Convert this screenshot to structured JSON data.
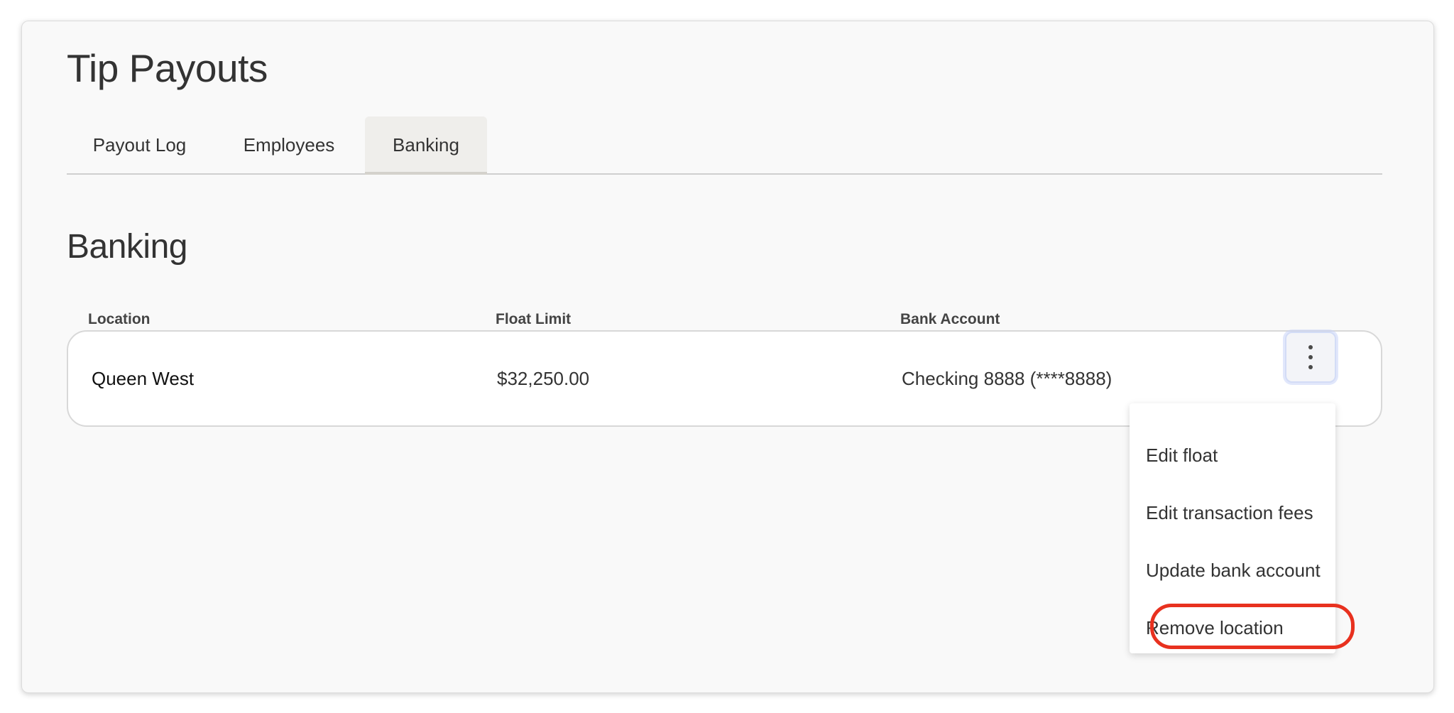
{
  "header": {
    "title": "Tip Payouts"
  },
  "tabs": [
    {
      "label": "Payout Log",
      "active": false
    },
    {
      "label": "Employees",
      "active": false
    },
    {
      "label": "Banking",
      "active": true
    }
  ],
  "section": {
    "title": "Banking"
  },
  "table": {
    "columns": [
      "Location",
      "Float Limit",
      "Bank Account"
    ],
    "rows": [
      {
        "location": "Queen West",
        "float_limit": "$32,250.00",
        "bank_account": "Checking 8888 (****8888)"
      }
    ]
  },
  "row_actions": {
    "button_icon": "more-vertical-icon",
    "menu_items": [
      {
        "label": "Edit float"
      },
      {
        "label": "Edit transaction fees"
      },
      {
        "label": "Update bank account"
      },
      {
        "label": "Remove location",
        "highlighted": true
      }
    ]
  },
  "colors": {
    "highlight": "#e8311f",
    "active_tab_bg": "#efeeeb"
  }
}
